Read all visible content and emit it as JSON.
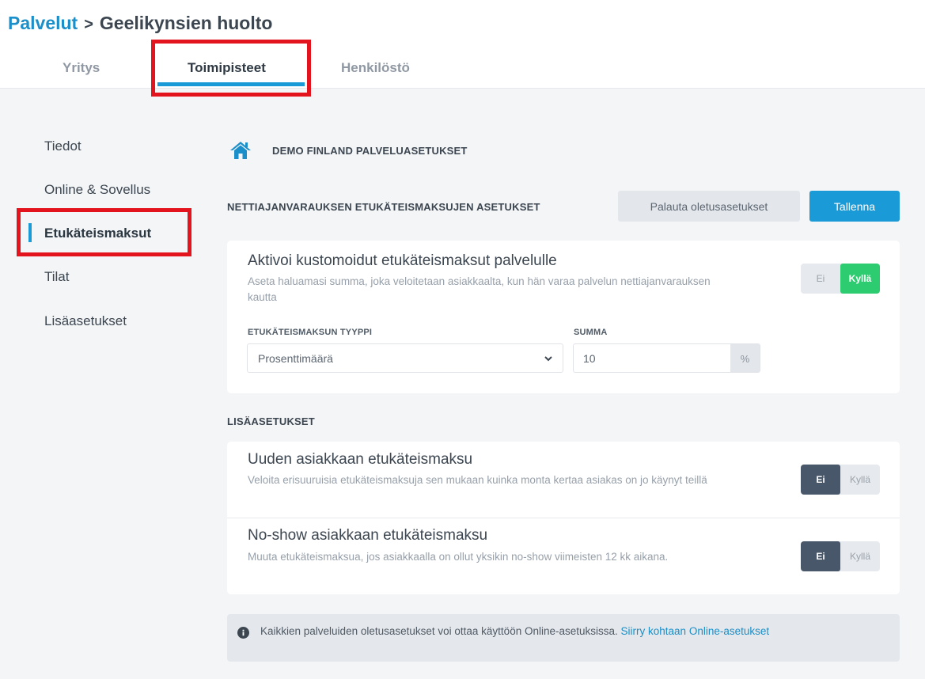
{
  "header": {
    "breadcrumb_root": "Palvelut",
    "breadcrumb_separator": ">",
    "breadcrumb_current": "Geelikynsien huolto"
  },
  "tabs": [
    {
      "label": "Yritys",
      "active": false
    },
    {
      "label": "Toimipisteet",
      "active": true
    },
    {
      "label": "Henkilöstö",
      "active": false
    }
  ],
  "sidebar": {
    "items": [
      {
        "label": "Tiedot",
        "active": false
      },
      {
        "label": "Online & Sovellus",
        "active": false
      },
      {
        "label": "Etukäteismaksut",
        "active": true
      },
      {
        "label": "Tilat",
        "active": false
      },
      {
        "label": "Lisäasetukset",
        "active": false
      }
    ]
  },
  "main": {
    "location_title": "DEMO FINLAND PALVELUASETUKSET",
    "location_icon": "home-icon",
    "section_title": "NETTIAJANVARAUKSEN ETUKÄTEISMAKSUJEN ASETUKSET",
    "reset_label": "Palauta oletusasetukset",
    "save_label": "Tallenna",
    "custom_card": {
      "title": "Aktivoi kustomoidut etukäteismaksut palvelulle",
      "description": "Aseta haluamasi summa, joka veloitetaan asiakkaalta, kun hän varaa palvelun nettiajanvarauksen kautta",
      "toggle_off": "Ei",
      "toggle_on": "Kyllä",
      "toggle_value": "Kyllä",
      "type_label": "ETUKÄTEISMAKSUN TYYPPI",
      "type_value": "Prosenttimäärä",
      "sum_label": "SUMMA",
      "sum_value": "10",
      "sum_unit": "%"
    },
    "extra_title": "LISÄASETUKSET",
    "new_customer": {
      "title": "Uuden asiakkaan etukäteismaksu",
      "description": "Veloita erisuuruisia etukäteismaksuja sen mukaan kuinka monta kertaa asiakas on jo käynyt teillä",
      "toggle_off": "Ei",
      "toggle_on": "Kyllä",
      "toggle_value": "Ei"
    },
    "no_show": {
      "title": "No-show asiakkaan etukäteismaksu",
      "description": "Muuta etukäteismaksua, jos asiakkaalla on ollut yksikin no-show viimeisten 12 kk aikana.",
      "toggle_off": "Ei",
      "toggle_on": "Kyllä",
      "toggle_value": "Ei"
    },
    "info": {
      "text": "Kaikkien palveluiden oletusasetukset voi ottaa käyttöön Online-asetuksissa.",
      "link": "Siirry kohtaan Online-asetukset"
    }
  },
  "colors": {
    "accent": "#1a9ad6",
    "toggle_on": "#2ecc71",
    "toggle_dark": "#48576a",
    "highlight": "#e4141e"
  }
}
